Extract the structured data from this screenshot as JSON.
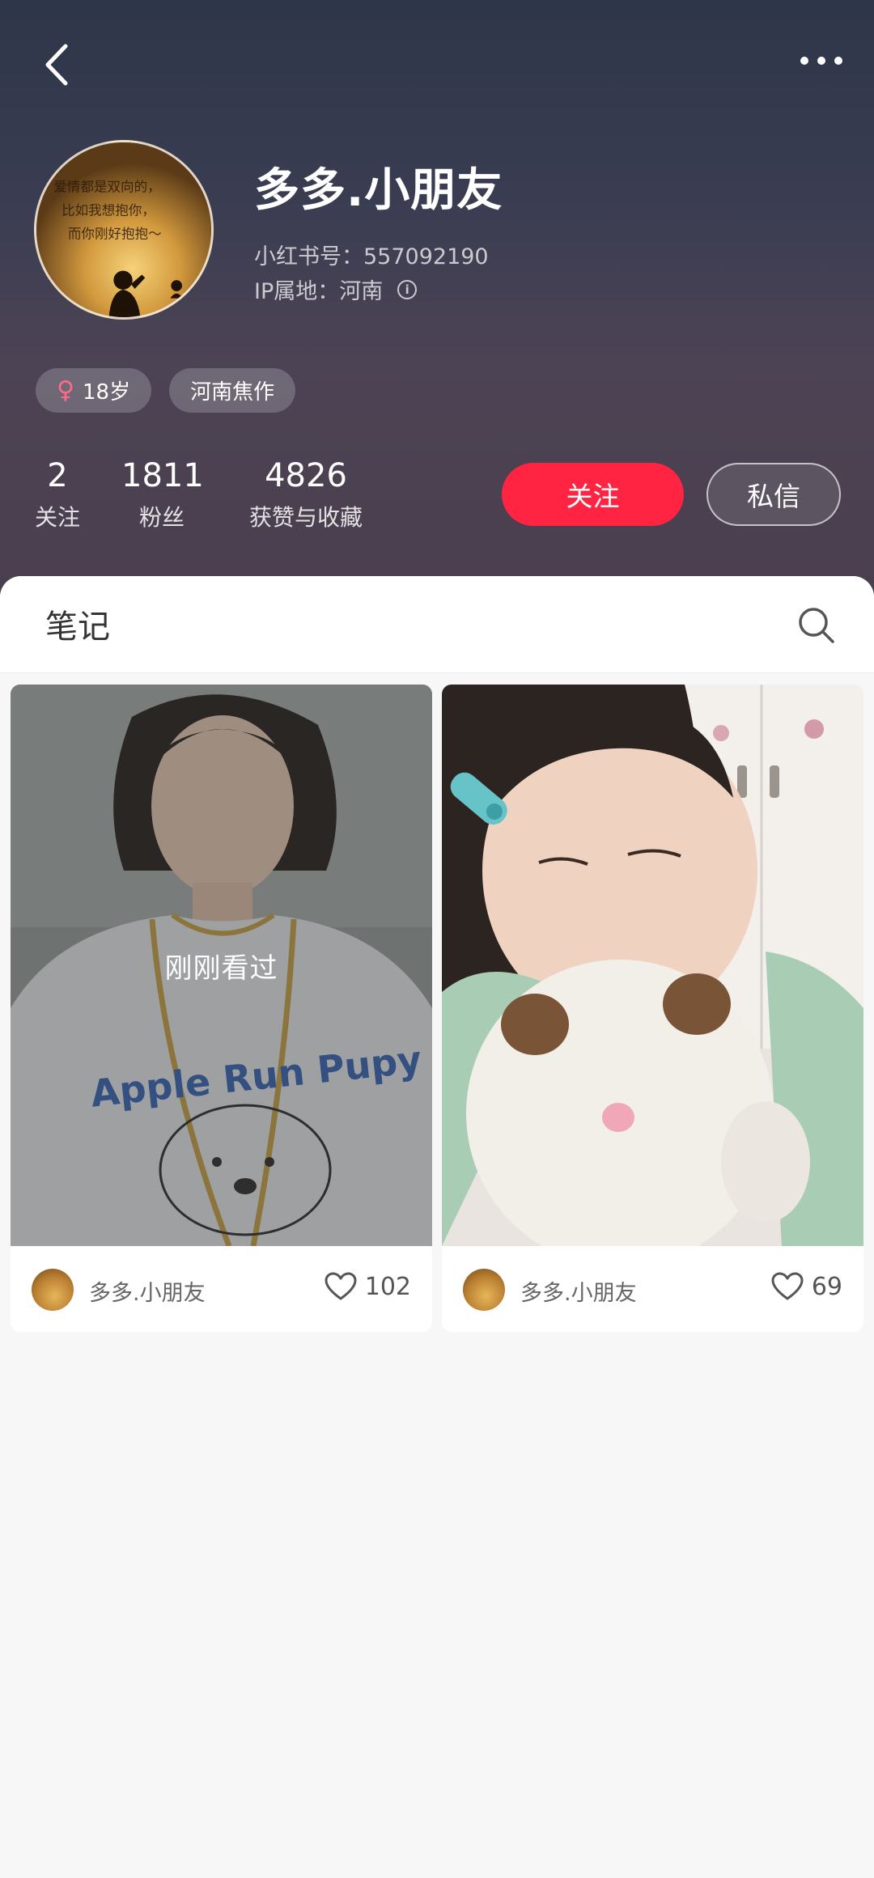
{
  "profile": {
    "nickname": "多多.小朋友",
    "id_line": "小红书号：557092190",
    "ip_line": "IP属地：河南",
    "info_glyph": "i",
    "avatar_text": "爱情都是双向的，比如我想抱你，而你刚好抱抱～",
    "tags": [
      {
        "icon": "♀",
        "label": "18岁"
      },
      {
        "label": "河南焦作"
      }
    ],
    "stats": [
      {
        "value": "2",
        "label": "关注"
      },
      {
        "value": "1811",
        "label": "粉丝"
      },
      {
        "value": "4826",
        "label": "获赞与收藏"
      }
    ],
    "follow_label": "关注",
    "message_label": "私信"
  },
  "notes": {
    "tab_label": "笔记",
    "cards": [
      {
        "author": "多多.小朋友",
        "likes": "102",
        "viewed_label": "刚刚看过",
        "shirt_text": "Apple Run Pupy"
      },
      {
        "author": "多多.小朋友",
        "likes": "69"
      }
    ]
  },
  "colors": {
    "accent": "#ff2442",
    "header_top": "#2e3649",
    "header_bottom": "#4a3f4e"
  }
}
